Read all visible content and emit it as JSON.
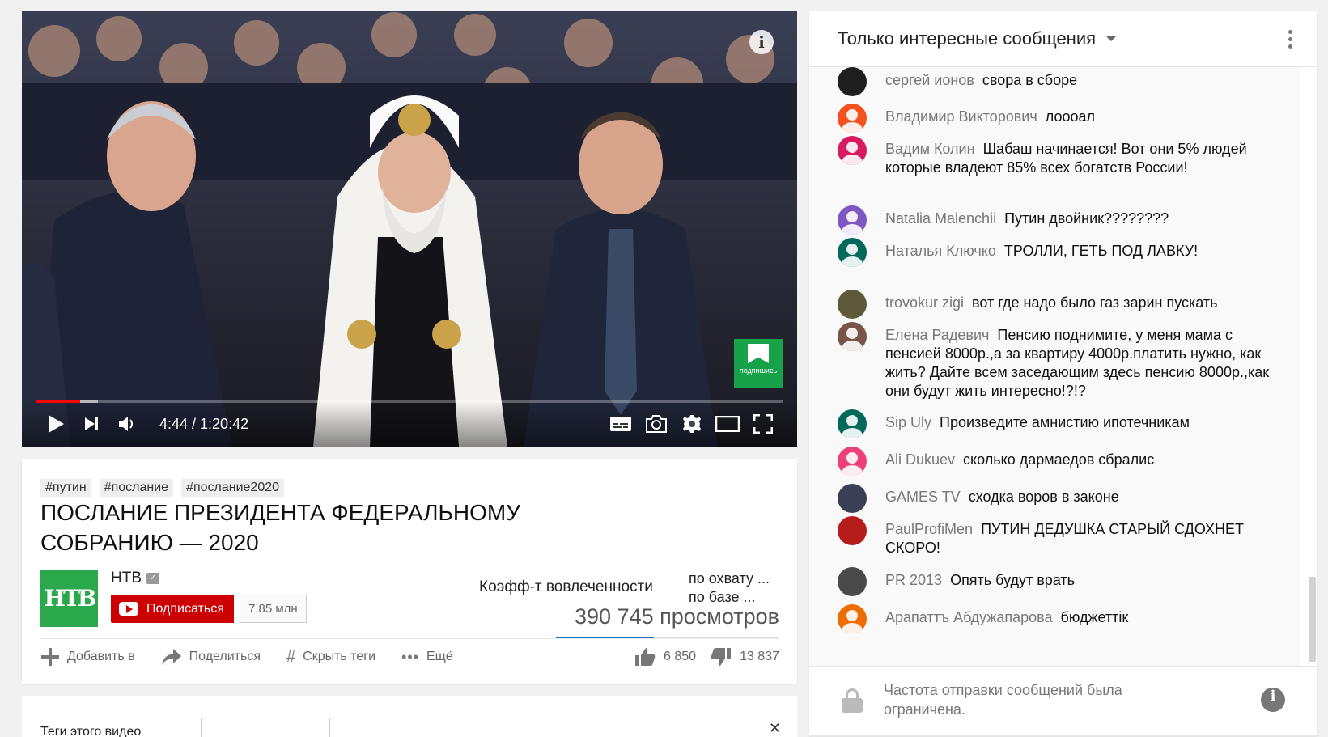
{
  "player": {
    "time": "4:44 / 1:20:42",
    "progress_played": 0.059,
    "progress_buffered": 0.083,
    "info_icon": "info-icon",
    "watermark_text": "подпишись",
    "accent_color": "#ff0000",
    "controls": [
      "play-icon",
      "next-icon",
      "volume-icon",
      "subtitles-icon",
      "screenshot-icon",
      "settings-icon",
      "theater-mode-icon",
      "fullscreen-icon"
    ]
  },
  "video": {
    "tags": [
      "#путин",
      "#послание",
      "#послание2020"
    ],
    "title": "ПОСЛАНИЕ ПРЕЗИДЕНТА ФЕДЕРАЛЬНОМУ СОБРАНИЮ — 2020",
    "channel": {
      "name": "НТВ",
      "logo_text": "НТВ",
      "logo_color": "#2aa84b",
      "verified": true
    },
    "subscribe_label": "Подписаться",
    "subscriber_count": "7,85 млн",
    "engagement_label": "Коэфф-т вовлеченности",
    "reach_lines": [
      "по охвату ...",
      "по базе ..."
    ],
    "views": "390 745 просмотров",
    "actions": [
      {
        "label": "Добавить в",
        "icon": "plus-icon"
      },
      {
        "label": "Поделиться",
        "icon": "share-icon"
      },
      {
        "label": "Скрыть теги",
        "icon": "hash-icon"
      },
      {
        "label": "Ещё",
        "icon": "more-dots-icon"
      }
    ],
    "likes": "6 850",
    "dislikes": "13 837"
  },
  "tags_card": {
    "label": "Теги этого видео"
  },
  "chat": {
    "header_title": "Только интересные сообщения",
    "messages": [
      {
        "author": "сергей ионов",
        "text": "свора в сборе",
        "avatar_color": "#1e1e1e",
        "photo": true
      },
      {
        "author": "Владимир Викторович",
        "text": "лоооал",
        "avatar_color": "#f4511e",
        "photo": false
      },
      {
        "author": "Вадим Колин",
        "text": "Шабаш начинается! Вот они 5% людей которые владеют 85% всех богатств России!",
        "avatar_color": "#d81b60",
        "photo": false
      },
      {
        "author": "Natalia Malenchii",
        "text": "Путин двойник????????",
        "avatar_color": "#7e57c2",
        "photo": false
      },
      {
        "author": "Наталья Ключко",
        "text": "ТРОЛЛИ, ГЕТЬ ПОД ЛАВКУ!",
        "avatar_color": "#00695c",
        "photo": false
      },
      {
        "author": "trovokur zigi",
        "text": "вот где надо было газ зарин пускать",
        "avatar_color": "#5d5a3c",
        "photo": true
      },
      {
        "author": "Елена Радевич",
        "text": "Пенсию поднимите, у меня мама с пенсией 8000р.,а за квартиру 4000р.платить нужно, как жить? Дайте всем заседающим здесь пенсию 8000р.,как они будут жить интересно!?!?",
        "avatar_color": "#795548",
        "photo": false
      },
      {
        "author": "Sip Uly",
        "text": "Произведите амнистию ипотечникам",
        "avatar_color": "#00695c",
        "photo": false
      },
      {
        "author": "Ali Dukuev",
        "text": "сколько дармаедов сбралис",
        "avatar_color": "#ec407a",
        "photo": false
      },
      {
        "author": "GAMES TV",
        "text": "сходка воров в законе",
        "avatar_color": "#3a3f55",
        "photo": true
      },
      {
        "author": "PaulProfiMen",
        "text": "ПУТИН ДЕДУШКА СТАРЫЙ СДОХНЕТ СКОРО!",
        "avatar_color": "#b71c1c",
        "photo": true
      },
      {
        "author": "PR 2013",
        "text": "Опять будут врать",
        "avatar_color": "#4a4a4a",
        "photo": true
      },
      {
        "author": "Арапаттъ Абдужапарова",
        "text": "бюджеттік",
        "avatar_color": "#ef6c00",
        "photo": false
      }
    ],
    "footer_text": "Частота отправки сообщений была ограничена."
  }
}
